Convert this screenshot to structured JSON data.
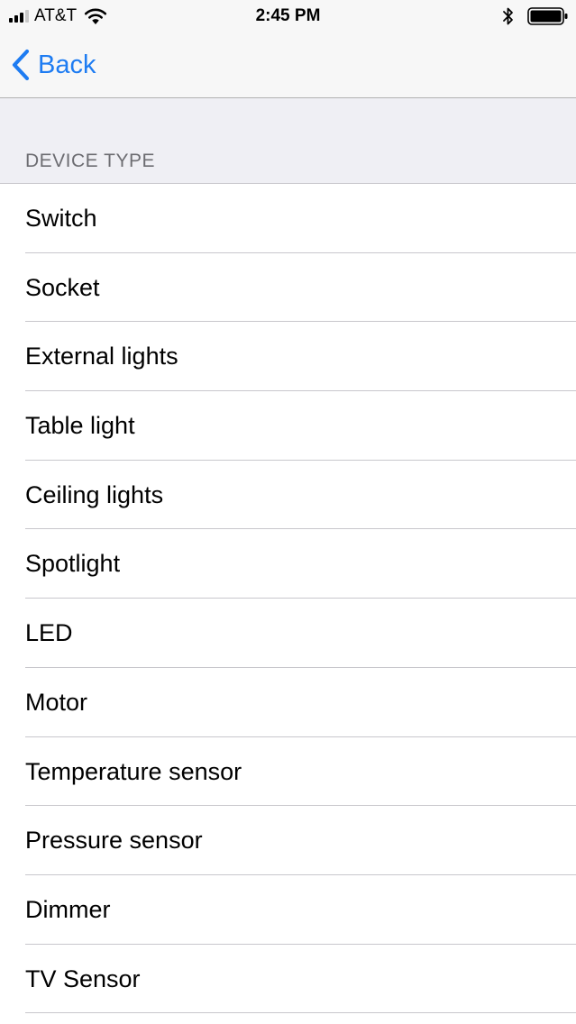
{
  "status_bar": {
    "carrier": "AT&T",
    "time": "2:45 PM",
    "signal_bars": 4,
    "signal_bars_active": 3,
    "icons": [
      "signal-icon",
      "wifi-icon",
      "bluetooth-icon",
      "battery-icon"
    ]
  },
  "nav": {
    "back_label": "Back",
    "back_icon": "chevron-left-icon",
    "accent_color": "#1e7cf2"
  },
  "section": {
    "title": "DEVICE TYPE"
  },
  "device_types": [
    {
      "label": "Switch"
    },
    {
      "label": "Socket"
    },
    {
      "label": "External lights"
    },
    {
      "label": "Table light"
    },
    {
      "label": "Ceiling lights"
    },
    {
      "label": "Spotlight"
    },
    {
      "label": "LED"
    },
    {
      "label": "Motor"
    },
    {
      "label": "Temperature sensor"
    },
    {
      "label": "Pressure sensor"
    },
    {
      "label": "Dimmer"
    },
    {
      "label": "TV Sensor"
    }
  ]
}
